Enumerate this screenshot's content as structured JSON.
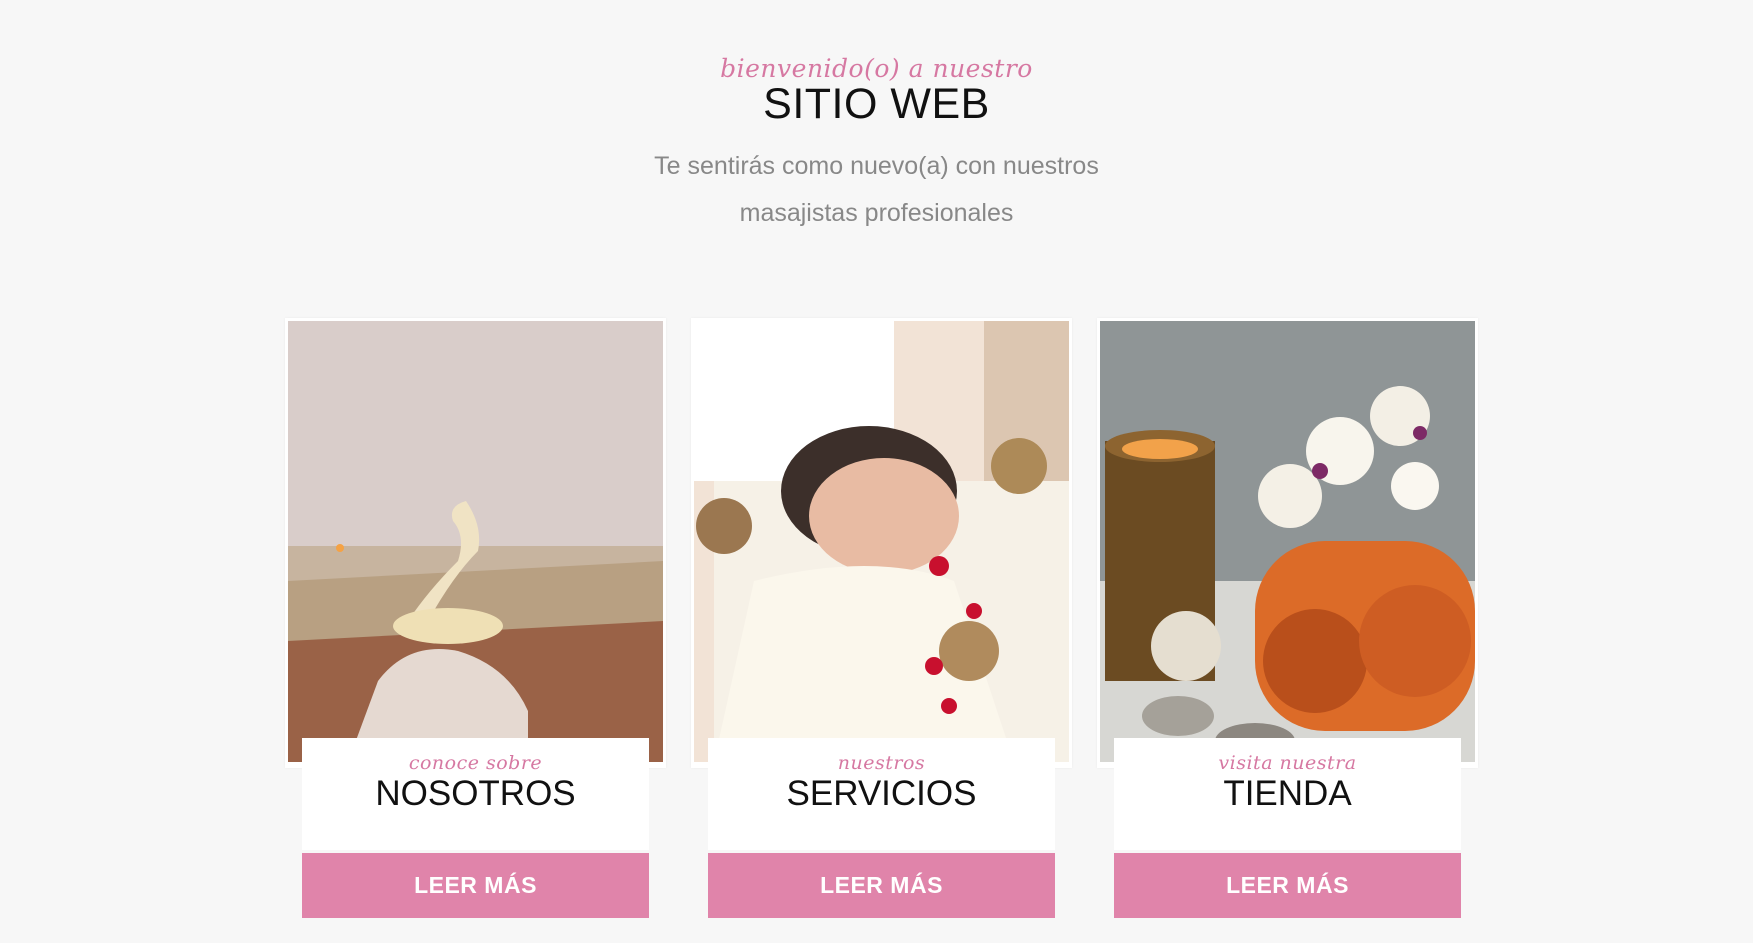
{
  "hero": {
    "script": "bienvenido(o) a nuestro",
    "title": "SITIO WEB",
    "subtitle_line1": "Te sentirás como nuevo(a) con nuestros",
    "subtitle_line2": "masajistas profesionales"
  },
  "cards": [
    {
      "script": "conoce sobre",
      "title": "NOSOTROS",
      "button_label": "LEER MÁS",
      "image": "spa-room-with-towel-swan"
    },
    {
      "script": "nuestros",
      "title": "SERVICIOS",
      "button_label": "LEER MÁS",
      "image": "woman-relaxing-with-singing-bowls-and-rose-petals"
    },
    {
      "script": "visita nuestra",
      "title": "TIENDA",
      "button_label": "LEER MÁS",
      "image": "candle-orchids-and-rolled-towels"
    }
  ],
  "colors": {
    "background": "#f7f7f7",
    "accent_pink": "#d678a2",
    "button_pink": "#e084aa",
    "title": "#111111",
    "subtitle": "#888888"
  }
}
